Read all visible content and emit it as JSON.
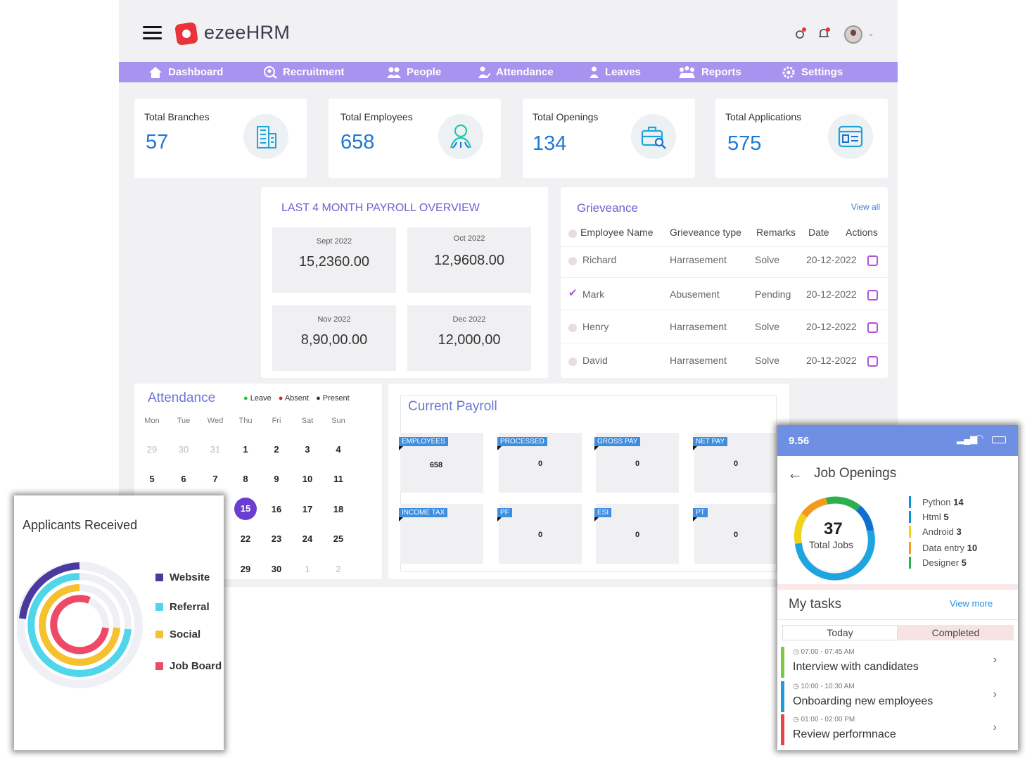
{
  "app": {
    "name": "ezeeHRM"
  },
  "nav": [
    "Dashboard",
    "Recruitment",
    "People",
    "Attendance",
    "Leaves",
    "Reports",
    "Settings"
  ],
  "stats": [
    {
      "label": "Total Branches",
      "value": "57"
    },
    {
      "label": "Total Employees",
      "value": "658"
    },
    {
      "label": "Total Openings",
      "value": "134"
    },
    {
      "label": "Total Applications",
      "value": "575"
    }
  ],
  "payroll_overview": {
    "title": "LAST 4 MONTH PAYROLL OVERVIEW",
    "months": [
      {
        "month": "Sept 2022",
        "amount": "15,2360.00"
      },
      {
        "month": "Oct 2022",
        "amount": "12,9608.00"
      },
      {
        "month": "Nov 2022",
        "amount": "8,90,00.00"
      },
      {
        "month": "Dec 2022",
        "amount": "12,000,00"
      }
    ]
  },
  "grievance": {
    "title": "Grieveance",
    "view_all": "View all",
    "headers": [
      "Employee Name",
      "Grieveance type",
      "Remarks",
      "Date",
      "Actions"
    ],
    "rows": [
      {
        "name": "Richard",
        "type": "Harrasement",
        "remarks": "Solve",
        "date": "20-12-2022"
      },
      {
        "name": "Mark",
        "type": "Abusement",
        "remarks": "Pending",
        "date": "20-12-2022"
      },
      {
        "name": "Henry",
        "type": "Harrasement",
        "remarks": "Solve",
        "date": "20-12-2022"
      },
      {
        "name": "David",
        "type": "Harrasement",
        "remarks": "Solve",
        "date": "20-12-2022"
      }
    ]
  },
  "attendance": {
    "title": "Attendance",
    "legend": [
      {
        "label": "Leave",
        "color": "#1ec81e"
      },
      {
        "label": "Absent",
        "color": "#e01b1b"
      },
      {
        "label": "Present",
        "color": "#333333"
      }
    ],
    "days": [
      "Mon",
      "Tue",
      "Wed",
      "Thu",
      "Fri",
      "Sat",
      "Sun"
    ],
    "weeks": [
      [
        "29",
        "30",
        "31",
        "1",
        "2",
        "3",
        "4"
      ],
      [
        "5",
        "6",
        "7",
        "8",
        "9",
        "10",
        "11"
      ],
      [
        "",
        "",
        "",
        "",
        "16",
        "17",
        "18"
      ],
      [
        "",
        "",
        "",
        "22",
        "23",
        "24",
        "25"
      ],
      [
        "",
        "",
        "",
        "29",
        "30",
        "1",
        "2"
      ]
    ],
    "partial": [
      "4",
      "1",
      "8"
    ],
    "today": "15"
  },
  "current_payroll": {
    "title": "Current Payroll",
    "tiles": [
      {
        "label": "EMPLOYEES",
        "value": "658"
      },
      {
        "label": "PROCESSED",
        "value": "0"
      },
      {
        "label": "GROSS PAY",
        "value": "0"
      },
      {
        "label": "NET PAY",
        "value": "0"
      },
      {
        "label": "INCOME TAX",
        "value": ""
      },
      {
        "label": "PF",
        "value": "0"
      },
      {
        "label": "ESI",
        "value": "0"
      },
      {
        "label": "PT",
        "value": "0"
      }
    ]
  },
  "applicants": {
    "title": "Applicants Received",
    "legend": [
      {
        "label": "Website",
        "color": "#4a3aa0"
      },
      {
        "label": "Referral",
        "color": "#4fd6ea"
      },
      {
        "label": "Social",
        "color": "#f5c12e"
      },
      {
        "label": "Job Board",
        "color": "#ee4a67"
      }
    ],
    "chart_data": {
      "type": "radial-bar",
      "categories": [
        "Website",
        "Referral",
        "Social",
        "Job Board"
      ]
    }
  },
  "mobile": {
    "time": "9.56",
    "title": "Job Openings",
    "total": "37",
    "total_label": "Total Jobs",
    "jobs": [
      {
        "name": "Python",
        "count": "14",
        "color": "#0f8fd6"
      },
      {
        "name": "Html",
        "count": "5",
        "color": "#0f8fd6"
      },
      {
        "name": "Android",
        "count": "3",
        "color": "#f2d21a"
      },
      {
        "name": "Data entry",
        "count": "10",
        "color": "#f39a1c"
      },
      {
        "name": "Designer",
        "count": "5",
        "color": "#2bb14b"
      }
    ],
    "chart_data": {
      "type": "pie",
      "categories": [
        "Python",
        "Html",
        "Android",
        "Data entry",
        "Designer"
      ],
      "values": [
        14,
        5,
        3,
        10,
        5
      ]
    },
    "tasks_title": "My tasks",
    "view_more": "View more",
    "tabs": [
      "Today",
      "Completed"
    ],
    "tasks": [
      {
        "time": "07:00 - 07:45 AM",
        "title": "Interview with candidates",
        "color": "#7ac943"
      },
      {
        "time": "10:00 - 10:30 AM",
        "title": "Onboarding new employees",
        "color": "#1e9bd8"
      },
      {
        "time": "01:00 - 02:00 PM",
        "title": "Review performnace",
        "color": "#e84545"
      }
    ]
  }
}
